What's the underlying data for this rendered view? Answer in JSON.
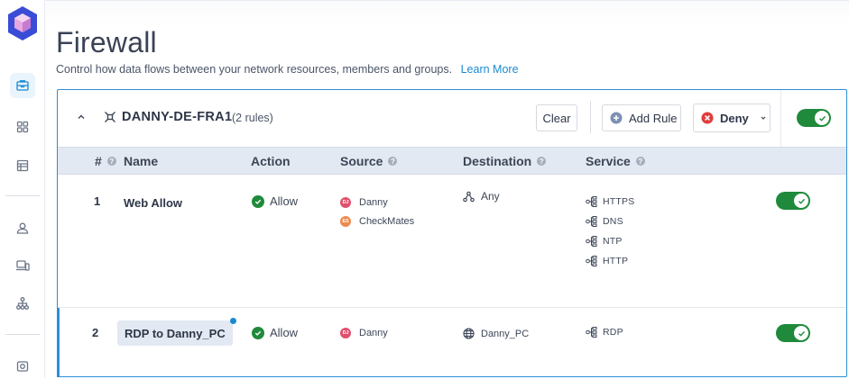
{
  "page": {
    "title": "Firewall",
    "subtitle": "Control how data flows between your network resources, members and groups.",
    "learn_more": "Learn More"
  },
  "group": {
    "name": "DANNY-DE-FRA1",
    "rule_count": "(2 rules)",
    "clear_label": "Clear",
    "add_rule_label": "Add Rule",
    "deny_label": "Deny",
    "enabled": true
  },
  "columns": {
    "num": "#",
    "name": "Name",
    "action": "Action",
    "source": "Source",
    "destination": "Destination",
    "service": "Service"
  },
  "rules": [
    {
      "num": "1",
      "name": "Web Allow",
      "action": "Allow",
      "sources": [
        {
          "initials": "DJ",
          "name": "Danny",
          "color": "#e0506c"
        },
        {
          "initials": "ES",
          "name": "CheckMates",
          "color": "#ec8a4e"
        }
      ],
      "destination": "Any",
      "services": [
        "HTTPS",
        "DNS",
        "NTP",
        "HTTP"
      ],
      "enabled": true
    },
    {
      "num": "2",
      "name": "RDP to Danny_PC",
      "action": "Allow",
      "sources": [
        {
          "initials": "DJ",
          "name": "Danny",
          "color": "#e0506c"
        }
      ],
      "destination": "Danny_PC",
      "services": [
        "RDP"
      ],
      "enabled": true
    }
  ],
  "colors": {
    "accent": "#2c8fd6",
    "success": "#1f8a3b",
    "danger": "#e03c3c",
    "header_bg": "#e3e9f2",
    "brand": "#3a4cd6"
  }
}
